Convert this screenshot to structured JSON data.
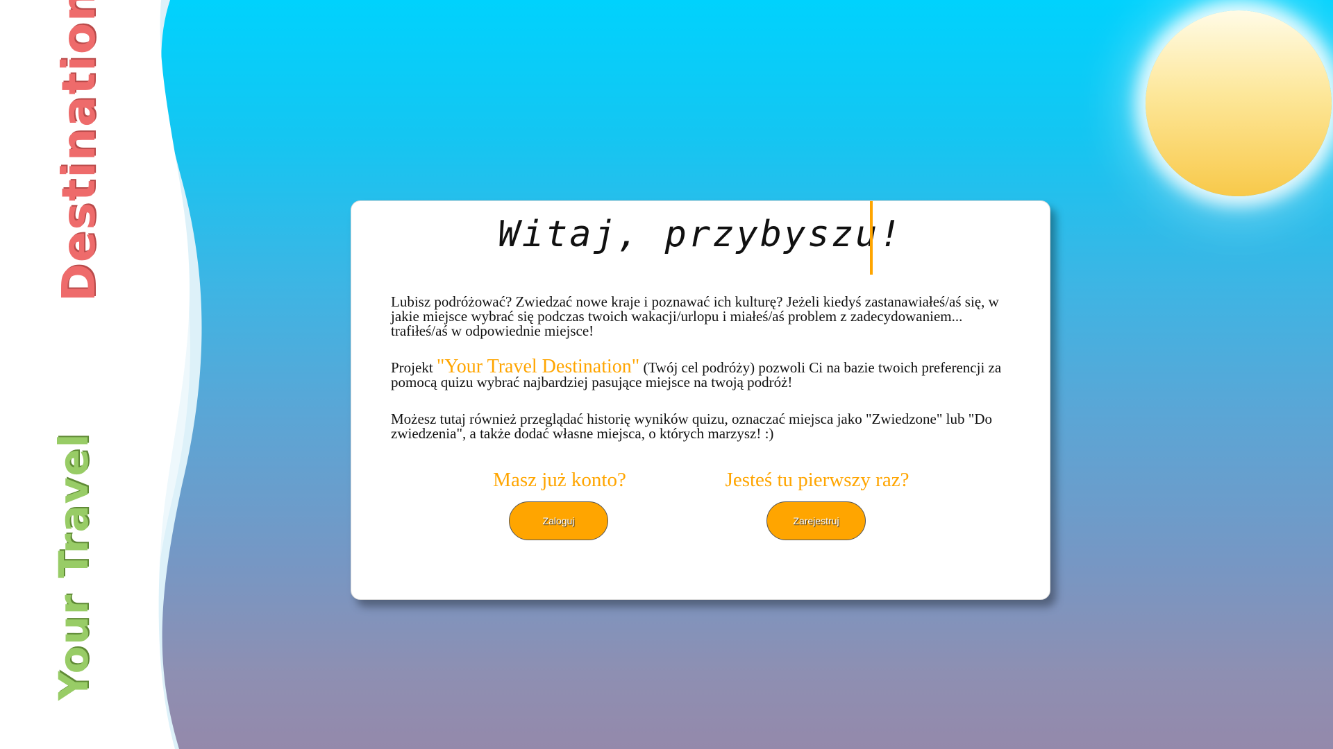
{
  "sidebar": {
    "brand_word_1": "Your Travel",
    "brand_word_2": "Destination"
  },
  "card": {
    "title": "Witaj, przybyszu!",
    "paragraph1": "Lubisz podróżować? Zwiedzać nowe kraje i poznawać ich kulturę? Jeżeli kiedyś zastanawiałeś/aś się, w jakie miejsce wybrać się podczas twoich wakacji/urlopu i miałeś/aś problem z zadecydowaniem... trafiłeś/aś w odpowiednie miejsce!",
    "paragraph2_prefix": "Projekt ",
    "paragraph2_highlight": "\"Your Travel Destination\"",
    "paragraph2_suffix": " (Twój cel podróży) pozwoli Ci na bazie twoich preferencji za pomocą quizu wybrać najbardziej pasujące miejsce na twoją podróż!",
    "paragraph3": "Możesz tutaj również przeglądać historię wyników quizu, oznaczać miejsca jako \"Zwiedzone\" lub \"Do zwiedzenia\", a także dodać własne miejsca, o których marzysz! :)",
    "login_question": "Masz już konto?",
    "login_button": "Zaloguj",
    "register_question": "Jesteś tu pierwszy raz?",
    "register_button": "Zarejestruj"
  },
  "colors": {
    "accent": "#ffa500",
    "destination_text": "#ee6b6b",
    "travel_text": "#98cc66",
    "sky_top": "#00d2fd",
    "sky_bottom": "#9489ab"
  }
}
